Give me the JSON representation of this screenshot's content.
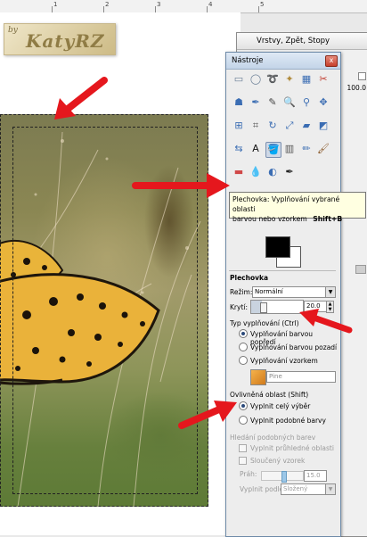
{
  "watermark": {
    "by": "by",
    "name": "KatyRZ"
  },
  "ruler": {
    "labels": [
      "1",
      "2",
      "3",
      "4",
      "5"
    ]
  },
  "layers_dialog": {
    "title": "Vrstvy, Zpět, Stopy",
    "value": "100.0"
  },
  "toolbox": {
    "title": "Nástroje",
    "close": "x",
    "tools": [
      {
        "name": "rect-select-icon",
        "glyph": "▭"
      },
      {
        "name": "ellipse-select-icon",
        "glyph": "◯"
      },
      {
        "name": "free-select-icon",
        "glyph": "➰"
      },
      {
        "name": "fuzzy-select-icon",
        "glyph": "✦"
      },
      {
        "name": "by-color-select-icon",
        "glyph": "▦"
      },
      {
        "name": "scissors-icon",
        "glyph": "✂"
      },
      {
        "name": "foreground-select-icon",
        "glyph": "☗"
      },
      {
        "name": "paths-icon",
        "glyph": "✒"
      },
      {
        "name": "color-picker-icon",
        "glyph": "✎"
      },
      {
        "name": "zoom-icon",
        "glyph": "🔍"
      },
      {
        "name": "measure-icon",
        "glyph": "⚲"
      },
      {
        "name": "move-icon",
        "glyph": "✥"
      },
      {
        "name": "align-icon",
        "glyph": "⊞"
      },
      {
        "name": "crop-icon",
        "glyph": "⌗"
      },
      {
        "name": "rotate-icon",
        "glyph": "↻"
      },
      {
        "name": "scale-icon",
        "glyph": "⤢"
      },
      {
        "name": "shear-icon",
        "glyph": "▰"
      },
      {
        "name": "perspective-icon",
        "glyph": "◩"
      },
      {
        "name": "flip-icon",
        "glyph": "⇆"
      },
      {
        "name": "text-icon",
        "glyph": "A"
      },
      {
        "name": "bucket-fill-icon",
        "glyph": "🪣"
      },
      {
        "name": "blend-icon",
        "glyph": "▥"
      },
      {
        "name": "pencil-icon",
        "glyph": "✏"
      },
      {
        "name": "paintbrush-icon",
        "glyph": "🖌"
      },
      {
        "name": "eraser-icon",
        "glyph": "▬"
      },
      {
        "name": "smudge-icon",
        "glyph": "💧"
      },
      {
        "name": "dodge-burn-icon",
        "glyph": "◐"
      },
      {
        "name": "ink-icon",
        "glyph": "✒"
      }
    ]
  },
  "tooltip": {
    "line1": "Plechovka: Vyplňování vybrané oblasti",
    "line2": "barvou nebo vzorkem",
    "shortcut": "Shift+B"
  },
  "tool_options": {
    "title": "Plechovka",
    "mode_label": "Režim:",
    "mode_value": "Normální",
    "opacity_label": "Krytí:",
    "opacity_value": "20.0",
    "fill_type_label": "Typ vyplňování  (Ctrl)",
    "fill_type_options": [
      "Vyplňování barvou popředí",
      "Vyplňování barvou pozadí",
      "Vyplňování vzorkem"
    ],
    "pattern_name": "Pine",
    "affected_label": "Ovlivněná oblast  (Shift)",
    "affected_options": [
      "Vyplnit celý výběr",
      "Vyplnit podobné barvy"
    ],
    "similar_label": "Hledání podobných barev",
    "transparent_label": "Vyplnit průhledné oblasti",
    "merged_label": "Sloučený vzorek",
    "threshold_label": "Práh:",
    "threshold_value": "15.0",
    "fill_by_label": "Vyplnit podle:",
    "fill_by_value": "Složený"
  },
  "colors": {
    "arrow": "#e5171d",
    "accent": "#2b4a7a"
  }
}
